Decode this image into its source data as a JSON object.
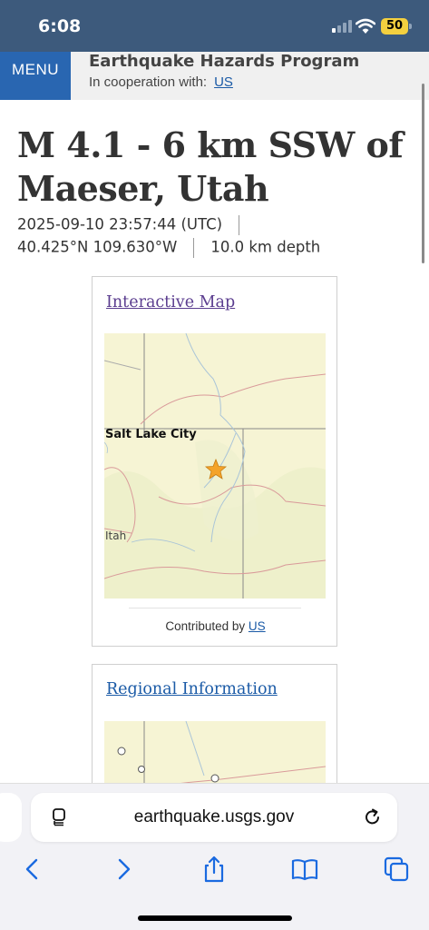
{
  "status_bar": {
    "time": "6:08",
    "battery": "50"
  },
  "header": {
    "menu_label": "MENU",
    "program": "Earthquake Hazards Program",
    "coop_text": "In cooperation with:",
    "coop_link": "US"
  },
  "event": {
    "title_line1": "M 4.1 - 6 km SSW of",
    "title_line2": "Maeser, Utah",
    "datetime": "2025-09-10 23:57:44 (UTC)",
    "coordinates": "40.425°N 109.630°W",
    "depth": "10.0 km depth"
  },
  "map_card": {
    "link": "Interactive Map",
    "city_label": "Salt Lake City",
    "state_label": "Itah",
    "contrib_text": "Contributed by",
    "contrib_link": "US"
  },
  "regional_card": {
    "link": "Regional Information"
  },
  "browser": {
    "url": "earthquake.usgs.gov"
  },
  "colors": {
    "header_bg": "#3d5a7c",
    "menu_bg": "#2966b1",
    "link": "#1a5aa6",
    "visited_link": "#5b3d8f",
    "epicenter": "#f4a32a",
    "map_bg": "#f6f4d4"
  }
}
